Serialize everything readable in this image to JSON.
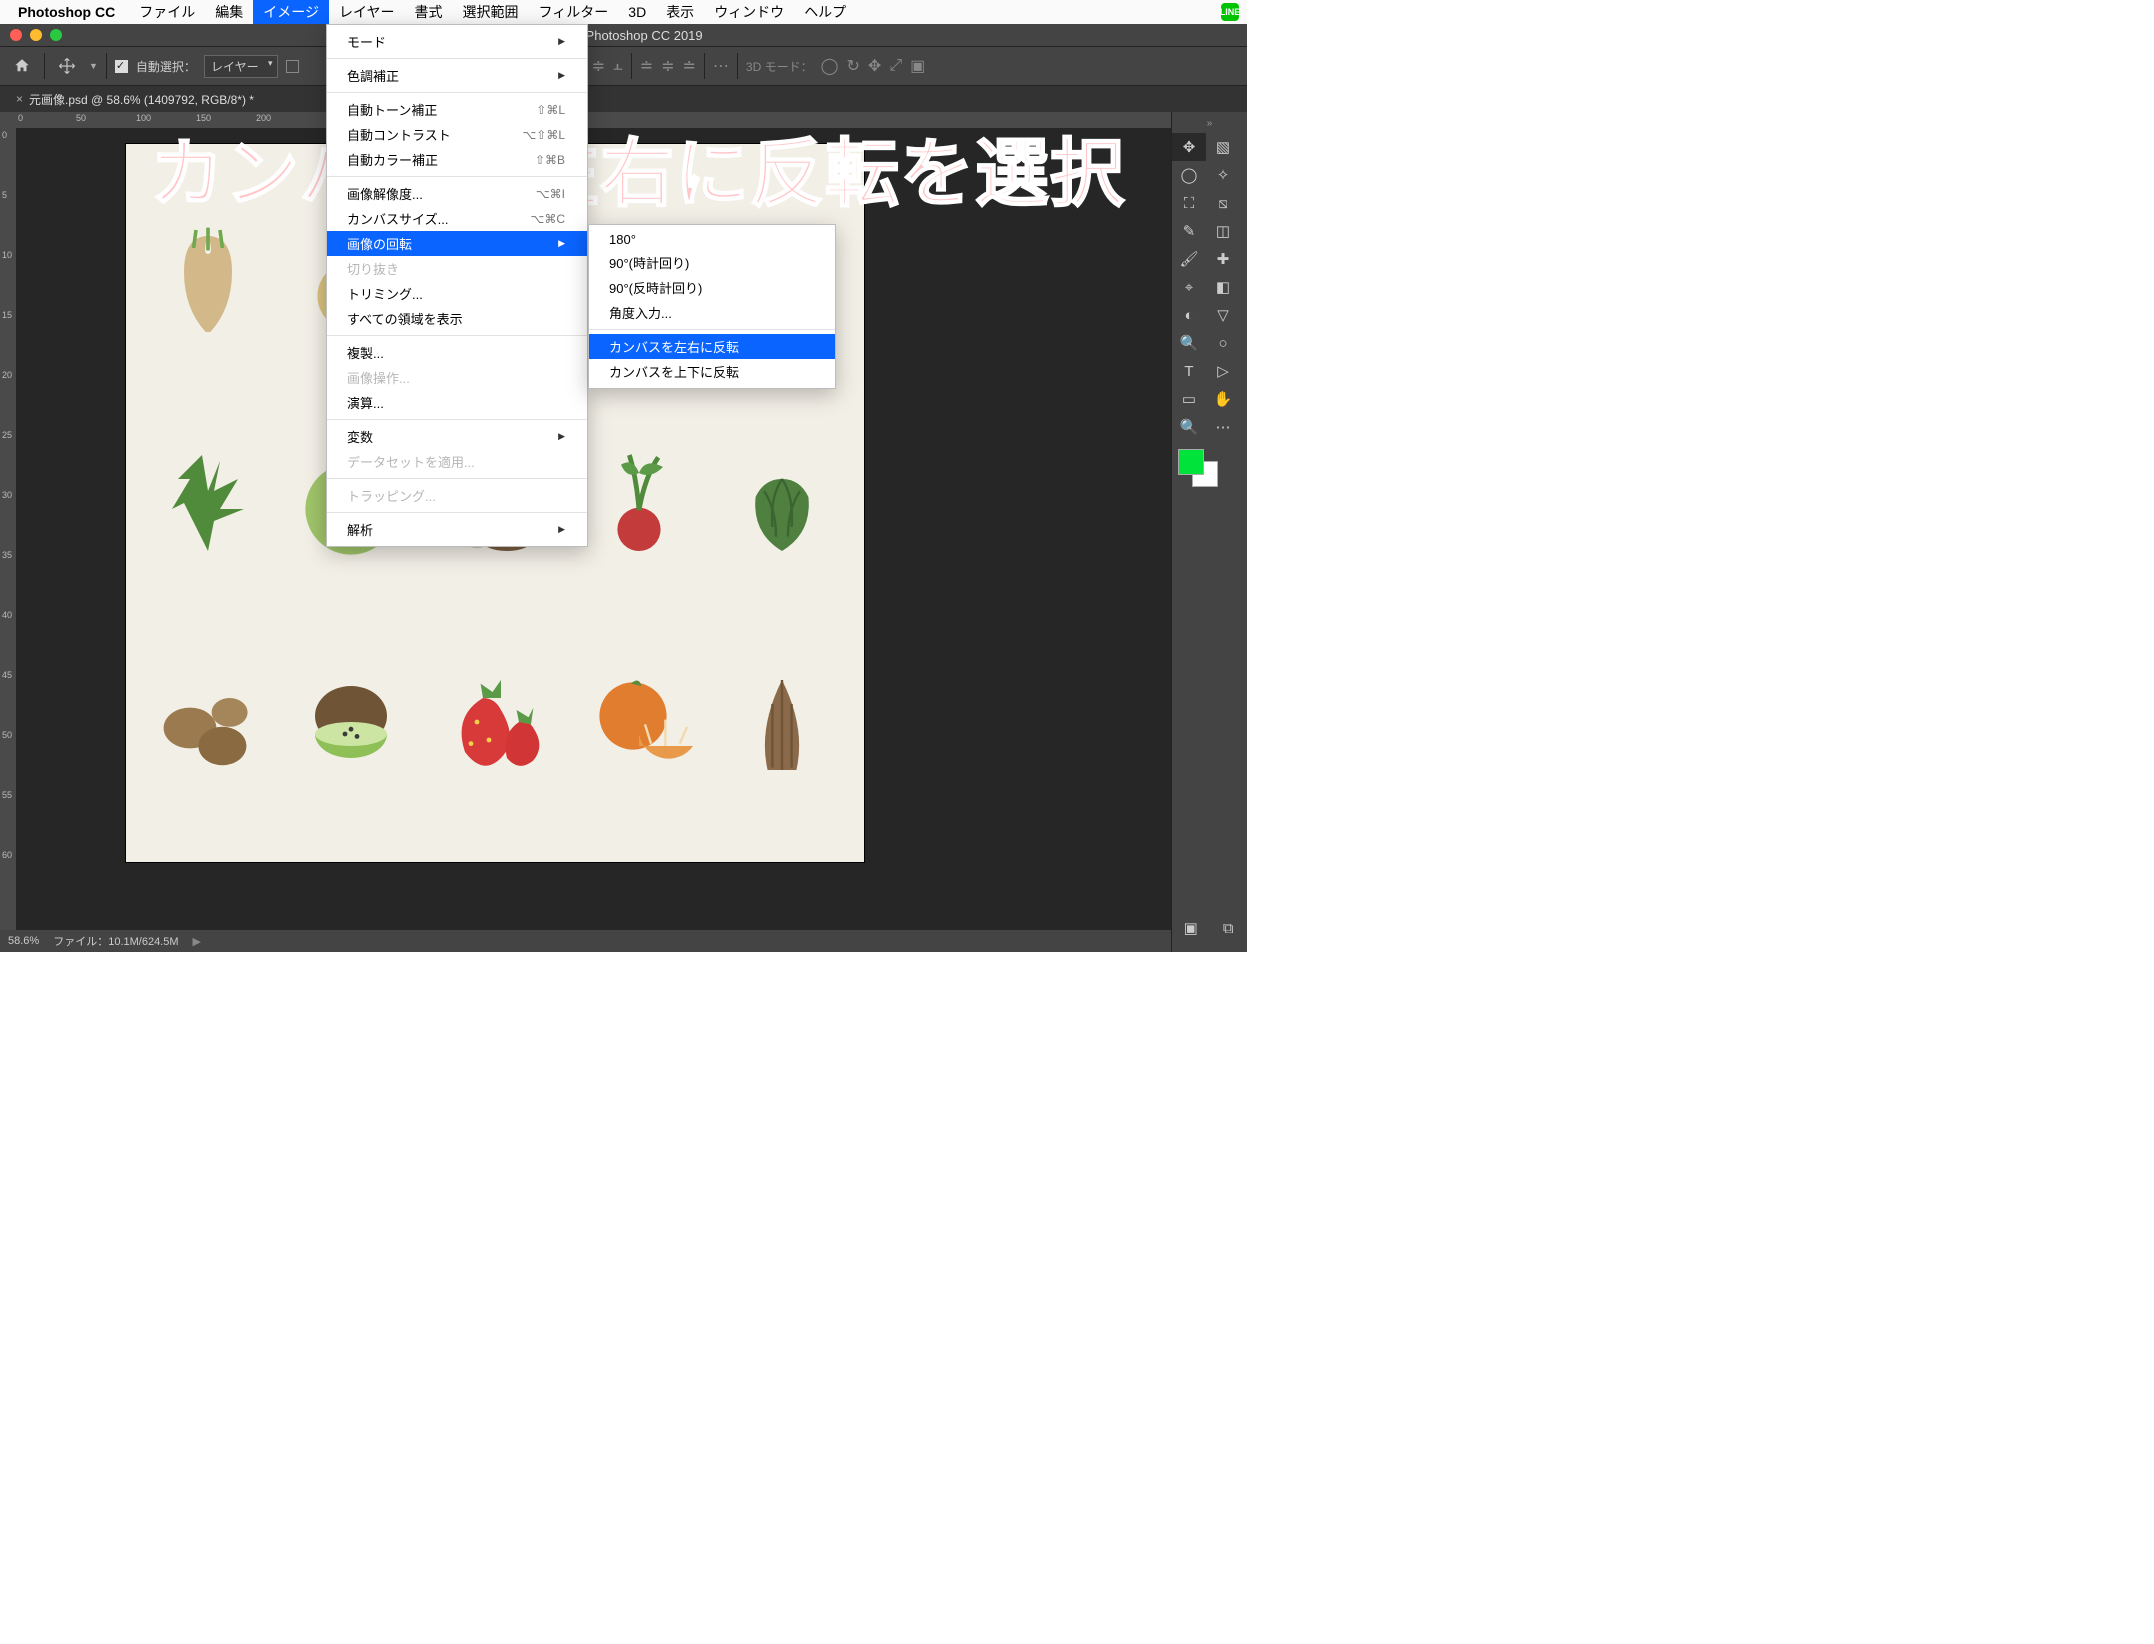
{
  "mac_menu": {
    "app": "Photoshop CC",
    "items": [
      "ファイル",
      "編集",
      "イメージ",
      "レイヤー",
      "書式",
      "選択範囲",
      "フィルター",
      "3D",
      "表示",
      "ウィンドウ",
      "ヘルプ"
    ],
    "active_index": 2,
    "line_label": "LINE"
  },
  "window": {
    "title": "Adobe Photoshop CC 2019"
  },
  "options_bar": {
    "auto_select_label": "自動選択：",
    "auto_select_value": "レイヤー",
    "threeD_mode_label": "3D モード："
  },
  "document_tab": {
    "label": "元画像.psd @ 58.6% (1409792, RGB/8*) *"
  },
  "ruler_h": [
    "0",
    "50",
    "100",
    "150",
    "200"
  ],
  "ruler_v": [
    "0",
    "5",
    "10",
    "15",
    "20",
    "25",
    "30",
    "35",
    "40",
    "45",
    "50",
    "55",
    "60"
  ],
  "status": {
    "zoom": "58.6%",
    "file_info": "ファイル：10.1M/624.5M"
  },
  "image_menu": {
    "groups": [
      [
        {
          "label": "モード",
          "sub": true
        }
      ],
      [
        {
          "label": "色調補正",
          "sub": true
        }
      ],
      [
        {
          "label": "自動トーン補正",
          "shortcut": "⇧⌘L"
        },
        {
          "label": "自動コントラスト",
          "shortcut": "⌥⇧⌘L"
        },
        {
          "label": "自動カラー補正",
          "shortcut": "⇧⌘B"
        }
      ],
      [
        {
          "label": "画像解像度...",
          "shortcut": "⌥⌘I"
        },
        {
          "label": "カンバスサイズ...",
          "shortcut": "⌥⌘C"
        },
        {
          "label": "画像の回転",
          "sub": true,
          "hl": true
        },
        {
          "label": "切り抜き",
          "disabled": true
        },
        {
          "label": "トリミング..."
        },
        {
          "label": "すべての領域を表示"
        }
      ],
      [
        {
          "label": "複製..."
        },
        {
          "label": "画像操作...",
          "disabled": true
        },
        {
          "label": "演算..."
        }
      ],
      [
        {
          "label": "変数",
          "sub": true,
          "disabled": false
        },
        {
          "label": "データセットを適用...",
          "disabled": true
        }
      ],
      [
        {
          "label": "トラッピング...",
          "disabled": true
        }
      ],
      [
        {
          "label": "解析",
          "sub": true
        }
      ]
    ]
  },
  "rotate_submenu": {
    "items": [
      {
        "label": "180°"
      },
      {
        "label": "90°(時計回り)"
      },
      {
        "label": "90°(反時計回り)"
      },
      {
        "label": "角度入力..."
      },
      {
        "sep": true
      },
      {
        "label": "カンバスを左右に反転",
        "hl": true
      },
      {
        "label": "カンバスを上下に反転"
      }
    ]
  },
  "annotation_text": "カンバスを左右に反転を選択",
  "tools": {
    "left": [
      "move",
      "lasso",
      "crop",
      "eyedropper",
      "brush",
      "clone",
      "gradient",
      "blur",
      "type",
      "rectangle",
      "zoom"
    ],
    "right": [
      "artboard",
      "magic-wand",
      "slice",
      "ruler",
      "eraser",
      "patch",
      "bucket",
      "dodge",
      "path-select",
      "shape-opt",
      "more"
    ]
  }
}
